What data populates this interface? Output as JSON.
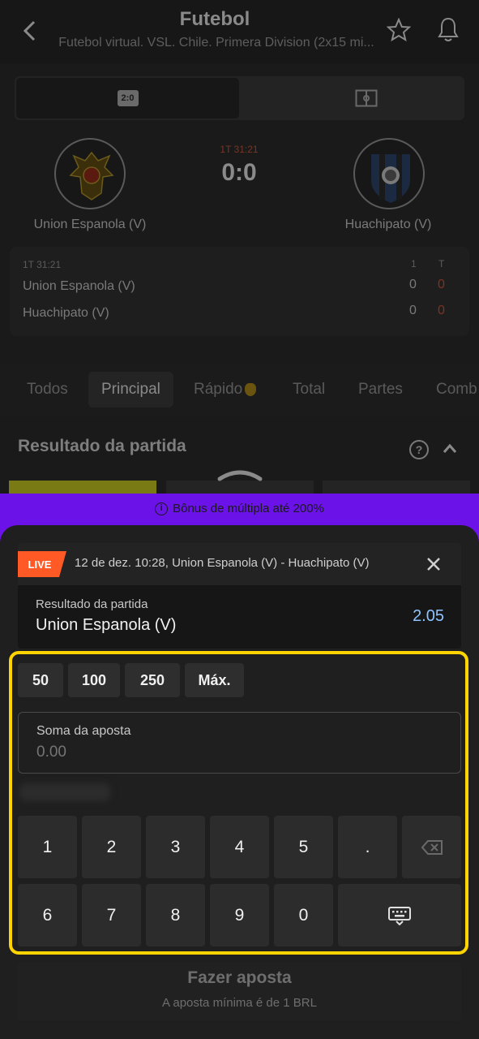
{
  "header": {
    "title": "Futebol",
    "subtitle": "Futebol virtual. VSL. Chile. Primera Division (2x15 mi..."
  },
  "view_toggle": {
    "score_icon_text": "2:0"
  },
  "match": {
    "time": "1T 31:21",
    "score": "0:0",
    "home": {
      "name": "Union Espanola (V)"
    },
    "away": {
      "name": "Huachipato (V)"
    }
  },
  "score_table": {
    "time": "1T 31:21",
    "col1": "1",
    "col2": "T",
    "rows": [
      {
        "team": "Union Espanola (V)",
        "p1": "0",
        "total": "0"
      },
      {
        "team": "Huachipato (V)",
        "p1": "0",
        "total": "0"
      }
    ]
  },
  "tabs": [
    "Todos",
    "Principal",
    "Rápido",
    "Total",
    "Partes",
    "Comb"
  ],
  "section": {
    "title": "Resultado da partida",
    "help": "?"
  },
  "bonus": {
    "text": "Bônus de múltipla até 200%"
  },
  "bet": {
    "badge": "LIVE",
    "event": "12 de dez. 10:28, Union Espanola (V) - Huachipato (V)",
    "market": "Resultado da partida",
    "selection": "Union Espanola (V)",
    "odd": "2.05"
  },
  "quick_amounts": [
    "50",
    "100",
    "250",
    "Máx."
  ],
  "stake": {
    "label": "Soma da aposta",
    "placeholder": "0.00"
  },
  "keypad": {
    "row1": [
      "1",
      "2",
      "3",
      "4",
      "5",
      "."
    ],
    "row2": [
      "6",
      "7",
      "8",
      "9",
      "0"
    ]
  },
  "place_bet": {
    "label": "Fazer aposta",
    "sub": "A aposta mínima é de 1 BRL"
  },
  "colors": {
    "accent_purple": "#6b12e8",
    "live_orange": "#ff5a26",
    "odd_blue": "#8fc3ff",
    "highlight_yellow": "#ffd400"
  }
}
